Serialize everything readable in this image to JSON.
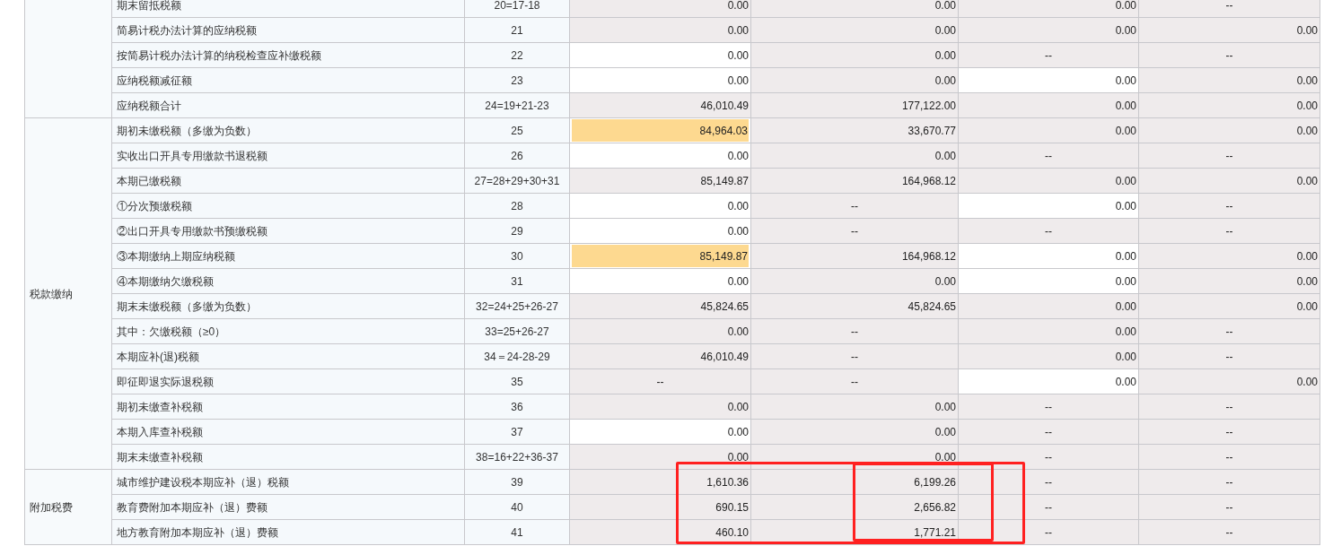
{
  "groups": [
    {
      "rows": [
        {
          "item": "期末留抵税额",
          "line": "20=17-18",
          "cells": [
            {
              "kind": "computed",
              "text": "0.00"
            },
            {
              "kind": "computed",
              "text": "0.00"
            },
            {
              "kind": "computed",
              "text": "0.00"
            },
            {
              "kind": "na",
              "text": "--"
            }
          ]
        },
        {
          "item": "简易计税办法计算的应纳税额",
          "line": "21",
          "cells": [
            {
              "kind": "computed",
              "text": "0.00"
            },
            {
              "kind": "computed",
              "text": "0.00"
            },
            {
              "kind": "computed",
              "text": "0.00"
            },
            {
              "kind": "computed",
              "text": "0.00"
            }
          ]
        },
        {
          "item": "按简易计税办法计算的纳税检查应补缴税额",
          "line": "22",
          "cells": [
            {
              "kind": "input",
              "text": "0.00"
            },
            {
              "kind": "computed",
              "text": "0.00"
            },
            {
              "kind": "na",
              "text": "--"
            },
            {
              "kind": "na",
              "text": "--"
            }
          ]
        },
        {
          "item": "应纳税额减征额",
          "line": "23",
          "cells": [
            {
              "kind": "input",
              "text": "0.00"
            },
            {
              "kind": "computed",
              "text": "0.00"
            },
            {
              "kind": "input",
              "text": "0.00"
            },
            {
              "kind": "computed",
              "text": "0.00"
            }
          ]
        },
        {
          "item": "应纳税额合计",
          "line": "24=19+21-23",
          "cells": [
            {
              "kind": "computed",
              "text": "46,010.49"
            },
            {
              "kind": "computed",
              "text": "177,122.00"
            },
            {
              "kind": "computed",
              "text": "0.00"
            },
            {
              "kind": "computed",
              "text": "0.00"
            }
          ]
        }
      ]
    },
    {
      "label": "税款缴纳",
      "rows": [
        {
          "item": "期初未缴税额（多缴为负数）",
          "line": "25",
          "cells": [
            {
              "kind": "flagged",
              "text": "84,964.03"
            },
            {
              "kind": "computed",
              "text": "33,670.77"
            },
            {
              "kind": "computed",
              "text": "0.00"
            },
            {
              "kind": "computed",
              "text": "0.00"
            }
          ]
        },
        {
          "item": "实收出口开具专用缴款书退税额",
          "line": "26",
          "cells": [
            {
              "kind": "input",
              "text": "0.00"
            },
            {
              "kind": "computed",
              "text": "0.00"
            },
            {
              "kind": "na",
              "text": "--"
            },
            {
              "kind": "na",
              "text": "--"
            }
          ]
        },
        {
          "item": "本期已缴税额",
          "line": "27=28+29+30+31",
          "cells": [
            {
              "kind": "computed",
              "text": "85,149.87"
            },
            {
              "kind": "computed",
              "text": "164,968.12"
            },
            {
              "kind": "computed",
              "text": "0.00"
            },
            {
              "kind": "computed",
              "text": "0.00"
            }
          ]
        },
        {
          "item": "①分次预缴税额",
          "line": "28",
          "cells": [
            {
              "kind": "input",
              "text": "0.00"
            },
            {
              "kind": "na",
              "text": "--"
            },
            {
              "kind": "input",
              "text": "0.00"
            },
            {
              "kind": "na",
              "text": "--"
            }
          ]
        },
        {
          "item": "②出口开具专用缴款书预缴税额",
          "line": "29",
          "cells": [
            {
              "kind": "input",
              "text": "0.00"
            },
            {
              "kind": "na",
              "text": "--"
            },
            {
              "kind": "na",
              "text": "--"
            },
            {
              "kind": "na",
              "text": "--"
            }
          ]
        },
        {
          "item": "③本期缴纳上期应纳税额",
          "line": "30",
          "cells": [
            {
              "kind": "flagged",
              "text": "85,149.87"
            },
            {
              "kind": "computed",
              "text": "164,968.12"
            },
            {
              "kind": "input",
              "text": "0.00"
            },
            {
              "kind": "computed",
              "text": "0.00"
            }
          ]
        },
        {
          "item": "④本期缴纳欠缴税额",
          "line": "31",
          "cells": [
            {
              "kind": "input",
              "text": "0.00"
            },
            {
              "kind": "computed",
              "text": "0.00"
            },
            {
              "kind": "input",
              "text": "0.00"
            },
            {
              "kind": "computed",
              "text": "0.00"
            }
          ]
        },
        {
          "item": "期末未缴税额（多缴为负数）",
          "line": "32=24+25+26-27",
          "cells": [
            {
              "kind": "computed",
              "text": "45,824.65"
            },
            {
              "kind": "computed",
              "text": "45,824.65"
            },
            {
              "kind": "computed",
              "text": "0.00"
            },
            {
              "kind": "computed",
              "text": "0.00"
            }
          ]
        },
        {
          "item": "其中：欠缴税额（≥0）",
          "line": "33=25+26-27",
          "cells": [
            {
              "kind": "computed",
              "text": "0.00"
            },
            {
              "kind": "na",
              "text": "--"
            },
            {
              "kind": "computed",
              "text": "0.00"
            },
            {
              "kind": "na",
              "text": "--"
            }
          ]
        },
        {
          "item": "本期应补(退)税额",
          "line": "34＝24-28-29",
          "cells": [
            {
              "kind": "computed",
              "text": "46,010.49"
            },
            {
              "kind": "na",
              "text": "--"
            },
            {
              "kind": "computed",
              "text": "0.00"
            },
            {
              "kind": "na",
              "text": "--"
            }
          ]
        },
        {
          "item": "即征即退实际退税额",
          "line": "35",
          "cells": [
            {
              "kind": "na",
              "text": "--"
            },
            {
              "kind": "na",
              "text": "--"
            },
            {
              "kind": "input",
              "text": "0.00"
            },
            {
              "kind": "computed",
              "text": "0.00"
            }
          ]
        },
        {
          "item": "期初未缴查补税额",
          "line": "36",
          "cells": [
            {
              "kind": "computed",
              "text": "0.00"
            },
            {
              "kind": "computed",
              "text": "0.00"
            },
            {
              "kind": "na",
              "text": "--"
            },
            {
              "kind": "na",
              "text": "--"
            }
          ]
        },
        {
          "item": "本期入库查补税额",
          "line": "37",
          "cells": [
            {
              "kind": "input",
              "text": "0.00"
            },
            {
              "kind": "computed",
              "text": "0.00"
            },
            {
              "kind": "na",
              "text": "--"
            },
            {
              "kind": "na",
              "text": "--"
            }
          ]
        },
        {
          "item": "期末未缴查补税额",
          "line": "38=16+22+36-37",
          "cells": [
            {
              "kind": "computed",
              "text": "0.00"
            },
            {
              "kind": "computed",
              "text": "0.00"
            },
            {
              "kind": "na",
              "text": "--"
            },
            {
              "kind": "na",
              "text": "--"
            }
          ]
        }
      ]
    },
    {
      "label": "附加税费",
      "rows": [
        {
          "item": "城市维护建设税本期应补（退）税额",
          "line": "39",
          "cells": [
            {
              "kind": "computed",
              "text": "1,610.36"
            },
            {
              "kind": "computed",
              "text": "6,199.26"
            },
            {
              "kind": "na",
              "text": "--"
            },
            {
              "kind": "na",
              "text": "--"
            }
          ]
        },
        {
          "item": "教育费附加本期应补（退）费额",
          "line": "40",
          "cells": [
            {
              "kind": "computed",
              "text": "690.15"
            },
            {
              "kind": "computed",
              "text": "2,656.82"
            },
            {
              "kind": "na",
              "text": "--"
            },
            {
              "kind": "na",
              "text": "--"
            }
          ]
        },
        {
          "item": "地方教育附加本期应补（退）费额",
          "line": "41",
          "cells": [
            {
              "kind": "computed",
              "text": "460.10"
            },
            {
              "kind": "computed",
              "text": "1,771.21"
            },
            {
              "kind": "na",
              "text": "--"
            },
            {
              "kind": "na",
              "text": "--"
            }
          ]
        }
      ]
    }
  ]
}
